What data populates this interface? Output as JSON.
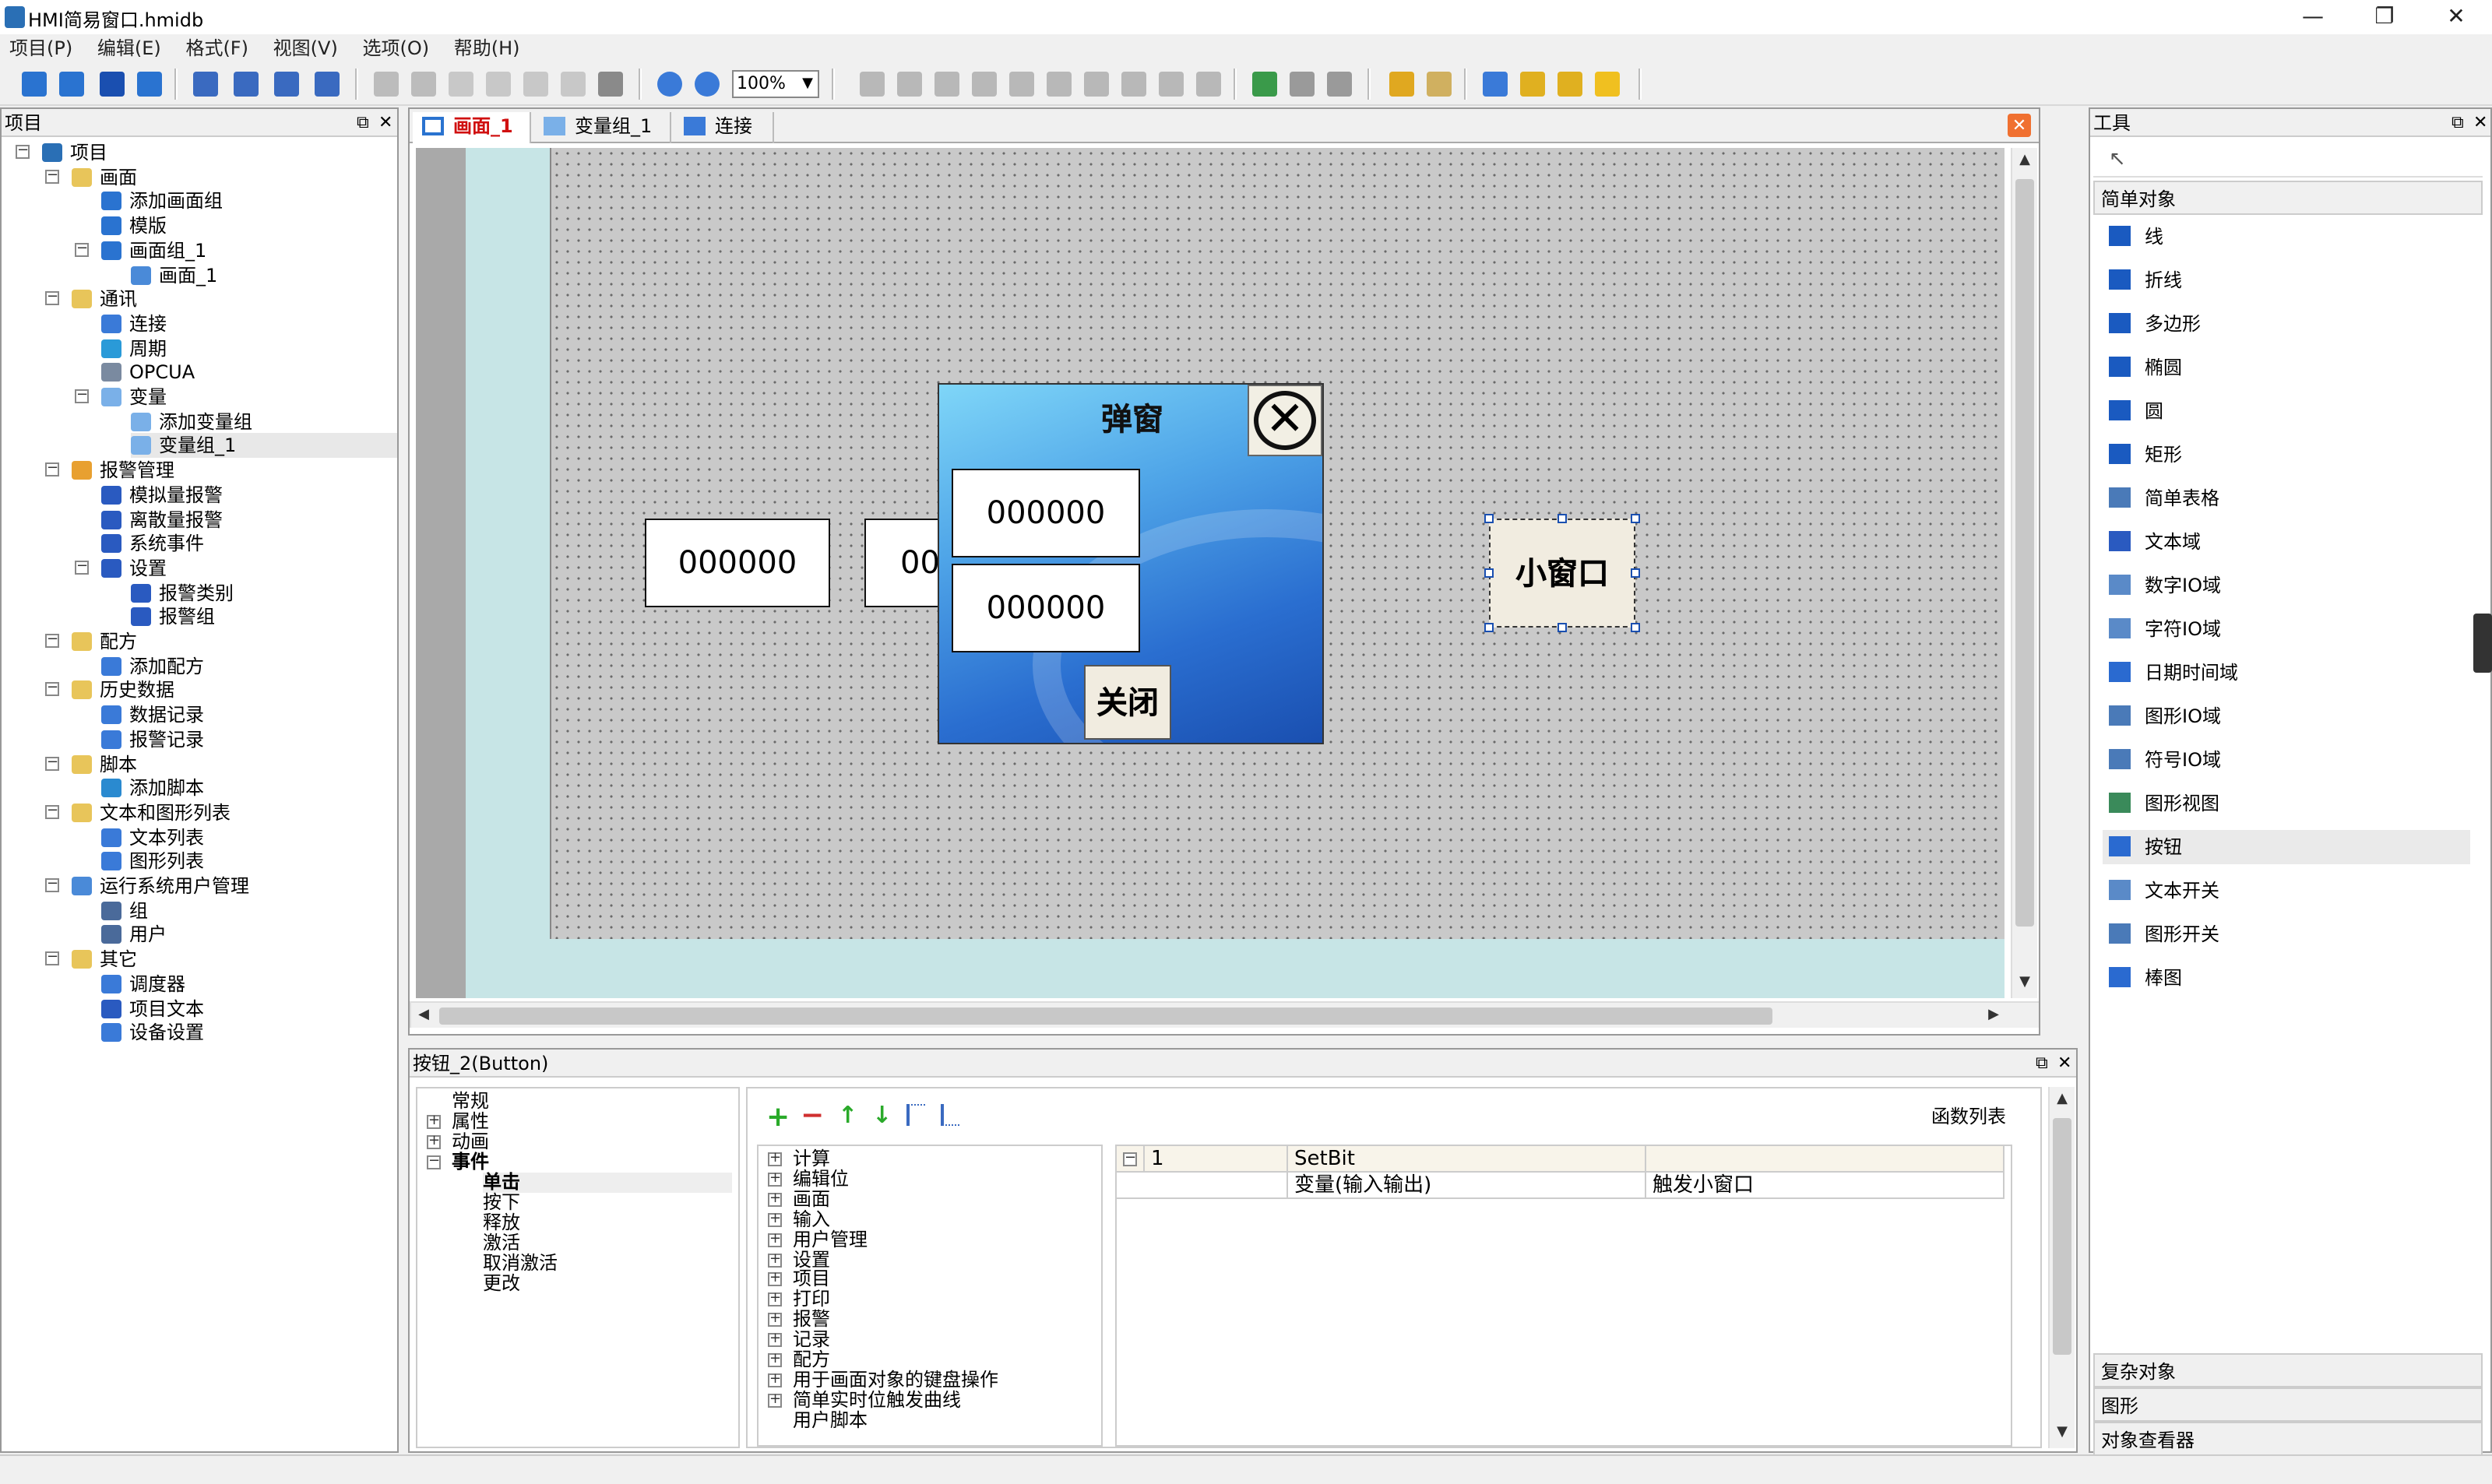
{
  "window": {
    "title": "HMI简易窗口.hmidb"
  },
  "menu": [
    "项目(P)",
    "编辑(E)",
    "格式(F)",
    "视图(V)",
    "选项(O)",
    "帮助(H)"
  ],
  "toolbar": {
    "zoom_value": "100%"
  },
  "project_panel": {
    "title": "项目",
    "tree": [
      {
        "label": "项目",
        "level": 0,
        "icon": "project-icon",
        "color": "#2a6fb5",
        "exp": "minus"
      },
      {
        "label": "画面",
        "level": 1,
        "icon": "folder-icon",
        "color": "#e8c55a",
        "exp": "minus"
      },
      {
        "label": "添加画面组",
        "level": 2,
        "icon": "add-screen-group-icon",
        "color": "#2a73d0"
      },
      {
        "label": "模版",
        "level": 2,
        "icon": "template-icon",
        "color": "#2a73d0"
      },
      {
        "label": "画面组_1",
        "level": 2,
        "icon": "screen-group-icon",
        "color": "#2a73d0",
        "exp": "minus"
      },
      {
        "label": "画面_1",
        "level": 3,
        "icon": "screen-icon",
        "color": "#4a8ad8"
      },
      {
        "label": "通讯",
        "level": 1,
        "icon": "folder-icon",
        "color": "#e8c55a",
        "exp": "minus"
      },
      {
        "label": "连接",
        "level": 2,
        "icon": "connection-icon",
        "color": "#3a7ad8"
      },
      {
        "label": "周期",
        "level": 2,
        "icon": "cycle-icon",
        "color": "#2a9ad8"
      },
      {
        "label": "OPCUA",
        "level": 2,
        "icon": "opcua-icon",
        "color": "#7a8aa0"
      },
      {
        "label": "变量",
        "level": 2,
        "icon": "tags-icon",
        "color": "#7ab0e8",
        "exp": "minus"
      },
      {
        "label": "添加变量组",
        "level": 3,
        "icon": "add-tag-group-icon",
        "color": "#7ab0e8"
      },
      {
        "label": "变量组_1",
        "level": 3,
        "icon": "tag-group-icon",
        "color": "#7ab0e8",
        "selected": true
      },
      {
        "label": "报警管理",
        "level": 1,
        "icon": "alarm-folder-icon",
        "color": "#e8a030",
        "exp": "minus"
      },
      {
        "label": "模拟量报警",
        "level": 2,
        "icon": "analog-alarm-icon",
        "color": "#2a5ac0"
      },
      {
        "label": "离散量报警",
        "level": 2,
        "icon": "discrete-alarm-icon",
        "color": "#2a5ac0"
      },
      {
        "label": "系统事件",
        "level": 2,
        "icon": "system-event-icon",
        "color": "#2a5ac0"
      },
      {
        "label": "设置",
        "level": 2,
        "icon": "settings-icon",
        "color": "#2a5ac0",
        "exp": "minus"
      },
      {
        "label": "报警类别",
        "level": 3,
        "icon": "alarm-class-icon",
        "color": "#2a5ac0"
      },
      {
        "label": "报警组",
        "level": 3,
        "icon": "alarm-group-icon",
        "color": "#2a5ac0"
      },
      {
        "label": "配方",
        "level": 1,
        "icon": "folder-icon",
        "color": "#e8c55a",
        "exp": "minus"
      },
      {
        "label": "添加配方",
        "level": 2,
        "icon": "add-recipe-icon",
        "color": "#3a7ad8"
      },
      {
        "label": "历史数据",
        "level": 1,
        "icon": "folder-icon",
        "color": "#e8c55a",
        "exp": "minus"
      },
      {
        "label": "数据记录",
        "level": 2,
        "icon": "data-log-icon",
        "color": "#3a7ad8"
      },
      {
        "label": "报警记录",
        "level": 2,
        "icon": "alarm-log-icon",
        "color": "#3a7ad8"
      },
      {
        "label": "脚本",
        "level": 1,
        "icon": "folder-icon",
        "color": "#e8c55a",
        "exp": "minus"
      },
      {
        "label": "添加脚本",
        "level": 2,
        "icon": "add-script-icon",
        "color": "#2a8ad0"
      },
      {
        "label": "文本和图形列表",
        "level": 1,
        "icon": "folder-icon",
        "color": "#e8c55a",
        "exp": "minus"
      },
      {
        "label": "文本列表",
        "level": 2,
        "icon": "text-list-icon",
        "color": "#3a7ad8"
      },
      {
        "label": "图形列表",
        "level": 2,
        "icon": "graphic-list-icon",
        "color": "#3a7ad8"
      },
      {
        "label": "运行系统用户管理",
        "level": 1,
        "icon": "user-admin-icon",
        "color": "#4a8ad8",
        "exp": "minus"
      },
      {
        "label": "组",
        "level": 2,
        "icon": "group-icon",
        "color": "#4a6a9a"
      },
      {
        "label": "用户",
        "level": 2,
        "icon": "user-icon",
        "color": "#4a6a9a"
      },
      {
        "label": "其它",
        "level": 1,
        "icon": "folder-icon",
        "color": "#e8c55a",
        "exp": "minus"
      },
      {
        "label": "调度器",
        "level": 2,
        "icon": "scheduler-icon",
        "color": "#3a7ad8"
      },
      {
        "label": "项目文本",
        "level": 2,
        "icon": "project-text-icon",
        "color": "#2a5ac0"
      },
      {
        "label": "设备设置",
        "level": 2,
        "icon": "device-settings-icon",
        "color": "#3a7ad8"
      }
    ]
  },
  "editor": {
    "tabs": [
      {
        "label": "画面_1",
        "active": true
      },
      {
        "label": "变量组_1",
        "active": false
      },
      {
        "label": "连接",
        "active": false
      }
    ],
    "screen": {
      "io_field_1": "000000",
      "io_field_2": "00",
      "popup_title": "弹窗",
      "popup_io_1": "000000",
      "popup_io_2": "000000",
      "popup_close_label": "关闭",
      "small_window_button": "小窗口"
    }
  },
  "tools_panel": {
    "title": "工具",
    "section_simple": "简单对象",
    "items": [
      {
        "label": "线",
        "icon": "line-icon",
        "color": "#1a5ac0"
      },
      {
        "label": "折线",
        "icon": "polyline-icon",
        "color": "#1a5ac0"
      },
      {
        "label": "多边形",
        "icon": "polygon-icon",
        "color": "#1a5ac0"
      },
      {
        "label": "椭圆",
        "icon": "ellipse-icon",
        "color": "#1a5ac0"
      },
      {
        "label": "圆",
        "icon": "circle-icon",
        "color": "#1a5ac0"
      },
      {
        "label": "矩形",
        "icon": "rectangle-icon",
        "color": "#1a5ac0"
      },
      {
        "label": "简单表格",
        "icon": "table-icon",
        "color": "#4a7ab8"
      },
      {
        "label": "文本域",
        "icon": "text-field-icon",
        "color": "#2a5ac0"
      },
      {
        "label": "数字IO域",
        "icon": "numeric-io-icon",
        "color": "#5a8ac8"
      },
      {
        "label": "字符IO域",
        "icon": "string-io-icon",
        "color": "#5a8ac8"
      },
      {
        "label": "日期时间域",
        "icon": "datetime-icon",
        "color": "#2a6ad0"
      },
      {
        "label": "图形IO域",
        "icon": "graphic-io-icon",
        "color": "#4a7ab8"
      },
      {
        "label": "符号IO域",
        "icon": "symbol-io-icon",
        "color": "#4a7ab8"
      },
      {
        "label": "图形视图",
        "icon": "graphic-view-icon",
        "color": "#3a8a5a"
      },
      {
        "label": "按钮",
        "icon": "button-icon",
        "color": "#2a6ad0",
        "selected": true
      },
      {
        "label": "文本开关",
        "icon": "text-switch-icon",
        "color": "#5a8ac8"
      },
      {
        "label": "图形开关",
        "icon": "graphic-switch-icon",
        "color": "#4a7ab8"
      },
      {
        "label": "棒图",
        "icon": "bar-graph-icon",
        "color": "#2a6ad0"
      }
    ],
    "section_complex": "复杂对象",
    "section_graphics": "图形",
    "section_viewer": "对象查看器"
  },
  "properties": {
    "title": "按钮_2(Button)",
    "categories": [
      "常规",
      "属性",
      "动画",
      "事件"
    ],
    "events": [
      "单击",
      "按下",
      "释放",
      "激活",
      "取消激活",
      "更改"
    ],
    "function_list_label": "函数列表",
    "function_groups": [
      "计算",
      "编辑位",
      "画面",
      "输入",
      "用户管理",
      "设置",
      "项目",
      "打印",
      "报警",
      "记录",
      "配方",
      "用于画面对象的键盘操作",
      "简单实时位触发曲线",
      "用户脚本"
    ],
    "function_table": {
      "row_index": "1",
      "function_name": "SetBit",
      "param_name": "变量(输入输出)",
      "param_value": "触发小窗口"
    }
  }
}
